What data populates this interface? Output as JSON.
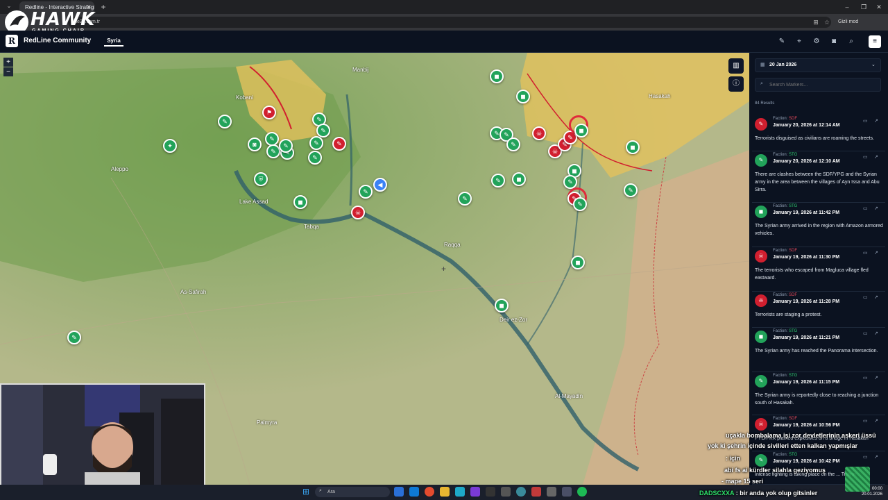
{
  "browser": {
    "tab_title": "Redline - Interactive Strategic ...",
    "tab_close": "✕",
    "new_tab": "+",
    "url": "line24.com.tr",
    "incognito_label": "Gizli mod",
    "window_buttons": [
      "–",
      "❐",
      "✕"
    ]
  },
  "overlay_logo": {
    "brand": "HAWK",
    "tagline": "GAMING CHAIR"
  },
  "app": {
    "logo_letter": "R",
    "name": "RedLine Community",
    "nav_tab": "Syria",
    "header_icons": [
      "pencil-icon",
      "pin-icon",
      "gear-icon",
      "camera-icon",
      "search-icon"
    ],
    "menu_icon": "≡"
  },
  "map": {
    "zoom_in": "+",
    "zoom_out": "−",
    "places": [
      "Aleppo",
      "Lake Assad",
      "Raqqa",
      "Kobani",
      "Hasakah",
      "Deir ez-Zor",
      "Al-Mayadin",
      "Palmyra",
      "As-Safirah",
      "Manbij",
      "Tabqa"
    ],
    "colors": {
      "green": "#22a35a",
      "red": "#d11f2f",
      "blue": "#3b82f6",
      "sdf_zone": "#e3c25c"
    }
  },
  "sidebar": {
    "date": "20 Jan 2026",
    "search_placeholder": "Search Markers...",
    "results": "84 Results",
    "faction_label": "Faction:",
    "events": [
      {
        "faction": "SDF",
        "time": "January 20, 2026 at 12:14 AM",
        "text": "Terrorists disguised as civilians are roaming the streets."
      },
      {
        "faction": "STG",
        "time": "January 20, 2026 at 12:10 AM",
        "text": "There are clashes between the SDF/YPG and the Syrian army in the area between the villages of Ayn Issa and Abu Sirra."
      },
      {
        "faction": "STG",
        "time": "January 19, 2026 at 11:42 PM",
        "text": "The Syrian army arrived in the region with Amazon armored vehicles."
      },
      {
        "faction": "SDF",
        "time": "January 19, 2026 at 11:30 PM",
        "text": "The terrorists who escaped from Magluca village fled eastward."
      },
      {
        "faction": "SDF",
        "time": "January 19, 2026 at 11:28 PM",
        "text": "Terrorists are staging a protest."
      },
      {
        "faction": "STG",
        "time": "January 19, 2026 at 11:21 PM",
        "text": "The Syrian army has reached the Panorama intersection."
      },
      {
        "faction": "STG",
        "time": "January 19, 2026 at 11:15 PM",
        "text": "The Syrian army is reportedly close to reaching a junction south of Hasakah."
      },
      {
        "faction": "SDF",
        "time": "January 19, 2026 at 10:56 PM",
        "text": "PYD/PKK planted explosives on a bridge in Hasakah"
      },
      {
        "faction": "STG",
        "time": "January 19, 2026 at 10:42 PM",
        "text": "Intense fighting is taking place on the ... Tishrin"
      }
    ]
  },
  "chat": [
    {
      "user": "",
      "text": "uçakla bombalama işi zor devletlerinin askeri üssü"
    },
    {
      "user": "",
      "text": "yok ki şehrin içinde sivilleri etten kalkan yapmışlar"
    },
    {
      "user": "",
      "text": ": için"
    },
    {
      "user": "",
      "text": "abi fs ai kürdler silahla geziyomuş"
    },
    {
      "user": "",
      "text": "- mape 15 seri"
    },
    {
      "user": "DADSCXXA",
      "text": ": bir anda yok olup gitsinler"
    }
  ],
  "taskbar": {
    "search_label": "Ara",
    "time": "00:00",
    "date": "20.01.2026"
  }
}
